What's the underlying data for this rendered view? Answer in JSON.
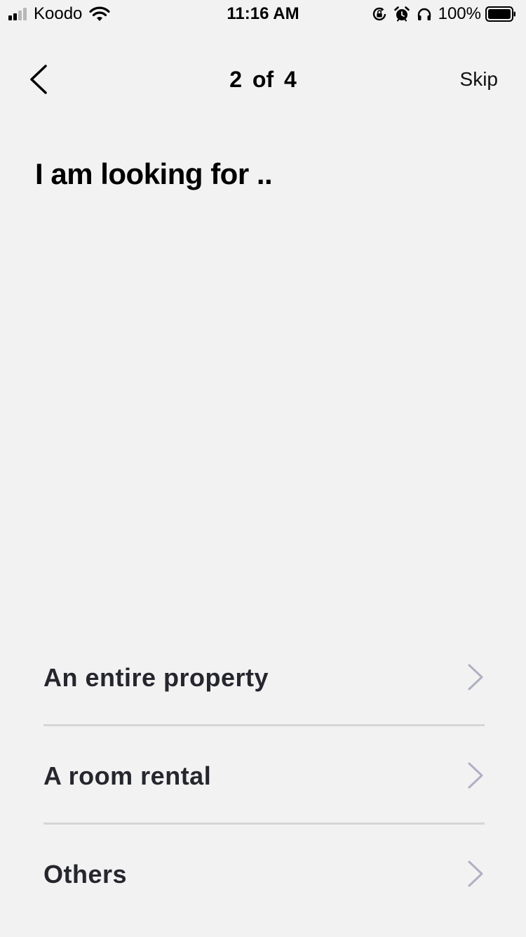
{
  "status_bar": {
    "carrier": "Koodo",
    "time": "11:16 AM",
    "battery": "100%"
  },
  "nav": {
    "progress": "2 of 4",
    "skip_label": "Skip"
  },
  "heading": "I am looking for ..",
  "options": [
    {
      "label": "An entire property"
    },
    {
      "label": "A room rental"
    },
    {
      "label": "Others"
    }
  ],
  "colors": {
    "background": "#f2f2f2",
    "option_text": "#26262e",
    "chevron": "#b0b0c4",
    "divider": "#d6d6d8"
  }
}
